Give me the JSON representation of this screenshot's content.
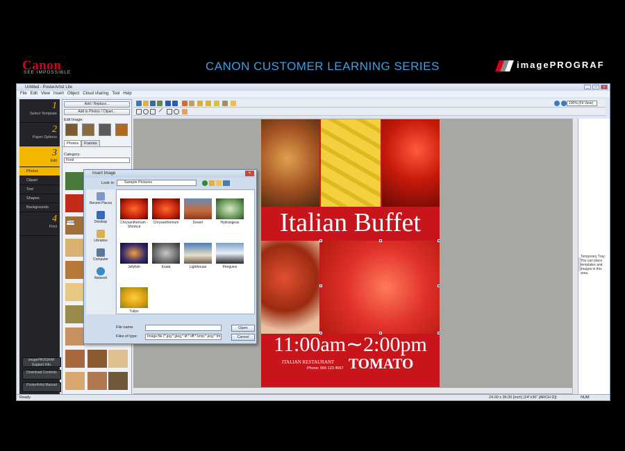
{
  "banner": {
    "brand": "Canon",
    "tagline": "SEE IMPOSSIBLE",
    "series_title": "CANON CUSTOMER LEARNING SERIES",
    "product": "imagePROGRAF"
  },
  "window": {
    "title": "Untitled - PosterArtist Lite",
    "menu": [
      "File",
      "Edit",
      "View",
      "Insert",
      "Object",
      "Cloud sharing",
      "Tool",
      "Help"
    ]
  },
  "steps": [
    {
      "num": "1",
      "label": "Select Template"
    },
    {
      "num": "2",
      "label": "Paper Options"
    },
    {
      "num": "3",
      "label": "Edit"
    },
    {
      "num": "4",
      "label": "Print"
    }
  ],
  "edit_subitems": [
    "Photos",
    "Clipart",
    "Text",
    "Shapes",
    "Backgrounds"
  ],
  "side_buttons": [
    "imagePROGRAF Support Info.",
    "Download Contents",
    "PosterArtist Manual"
  ],
  "panel": {
    "add_replace": "Add / Replace...",
    "add_photos": "Add to Photos / Clipart...",
    "edit_image": "Edit Image:",
    "tabs": [
      "Photos",
      "Frames"
    ],
    "category_label": "Category:",
    "category_value": "Food",
    "thumb_label": "Food"
  },
  "toolbar": {
    "zoom": "100% (Fit View)"
  },
  "tray": {
    "text": "Temporary Tray: You can place templates and images in this area."
  },
  "status": {
    "left": "Ready",
    "size": "24.00 x 36.00 [inch] (24\"x36\" [ARCH D])",
    "num": "NUM"
  },
  "poster": {
    "title": "Italian Buffet",
    "time": "11:00am∼2:00pm",
    "restaurant": "ITALIAN RESTAURANT",
    "phone": "Phone: 555 123 4567",
    "name": "TOMATO"
  },
  "dialog": {
    "title": "Insert Image",
    "look_in_label": "Look in:",
    "look_in_value": "Sample Pictures",
    "nav": [
      "Recent Places",
      "Desktop",
      "Libraries",
      "Computer",
      "Network"
    ],
    "files": [
      {
        "name": "Chrysanthemum - Shortcut"
      },
      {
        "name": "Chrysanthemum"
      },
      {
        "name": "Desert"
      },
      {
        "name": "Hydrangeas"
      },
      {
        "name": "Jellyfish"
      },
      {
        "name": "Koala"
      },
      {
        "name": "Lighthouse"
      },
      {
        "name": "Penguins"
      },
      {
        "name": "Tulips"
      }
    ],
    "file_name_label": "File name:",
    "file_name_value": "",
    "file_type_label": "Files of type:",
    "file_type_value": "Image file (*.jpg;*.jpeg;*.tif;*.tiff;*.bmp;*.png;*.fm",
    "open": "Open",
    "cancel": "Cancel"
  },
  "colors": {
    "canon_red": "#d8001e",
    "series_blue": "#3ba0e8",
    "step_yellow": "#f2b600",
    "poster_red": "#c8141b"
  }
}
